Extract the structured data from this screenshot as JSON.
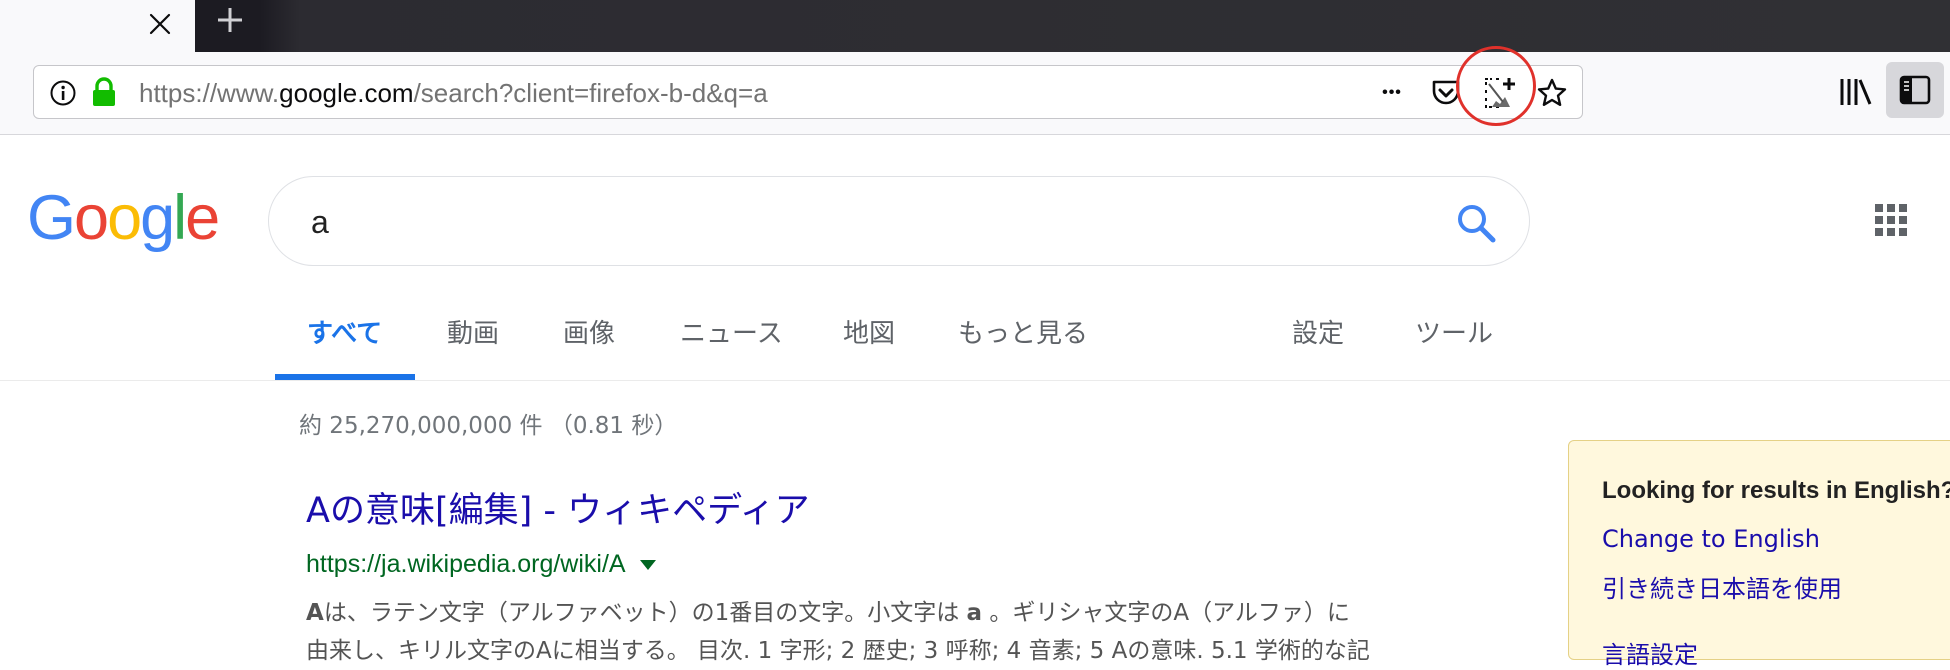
{
  "browser": {
    "tab_close_glyph": "✕",
    "new_tab_glyph": "+",
    "url": {
      "prefix": "https://www.",
      "domain": "google.com",
      "path": "/search?client=firefox-b-d&q=a"
    },
    "more_glyph": "•••",
    "icons": [
      "info-icon",
      "lock-icon",
      "page-actions-icon",
      "pocket-icon",
      "screenshot-icon",
      "bookmark-star-icon",
      "library-icon",
      "sidebar-icon"
    ],
    "highlight_color": "#e0312b"
  },
  "google": {
    "logo_letters": [
      {
        "char": "G",
        "color": "#4285f4"
      },
      {
        "char": "o",
        "color": "#ea4335"
      },
      {
        "char": "o",
        "color": "#fbbc05"
      },
      {
        "char": "g",
        "color": "#4285f4"
      },
      {
        "char": "l",
        "color": "#34a853"
      },
      {
        "char": "e",
        "color": "#ea4335"
      }
    ],
    "search_value": "a",
    "tabs": [
      {
        "label": "すべて",
        "active": true
      },
      {
        "label": "動画"
      },
      {
        "label": "画像"
      },
      {
        "label": "ニュース"
      },
      {
        "label": "地図"
      },
      {
        "label": "もっと見る"
      },
      {
        "label": "設定"
      },
      {
        "label": "ツール"
      }
    ],
    "result_stats": "約 25,270,000,000 件 （0.81 秒）",
    "result": {
      "title": "Aの意味[編集] - ウィキペディア",
      "url": "https://ja.wikipedia.org/wiki/A",
      "snippet_line1_a": "A",
      "snippet_line1_b": "は、ラテン文字（アルファベット）の1番目の文字。小文字は ",
      "snippet_line1_c": "a",
      "snippet_line1_d": " 。ギリシャ文字のA（アルファ）に",
      "snippet_line2": "由来し、キリル文字のAに相当する。 目次. 1 字形; 2 歴史; 3 呼称; 4 音素; 5 Aの意味. 5.1 学術的な記"
    },
    "language_panel": {
      "title": "Looking for results in English?",
      "link_english": "Change to English",
      "link_japanese": "引き続き日本語を使用",
      "link_settings": "言語設定"
    },
    "colors": {
      "link": "#1a0dab",
      "url": "#006621",
      "accent": "#1a73e8"
    }
  }
}
